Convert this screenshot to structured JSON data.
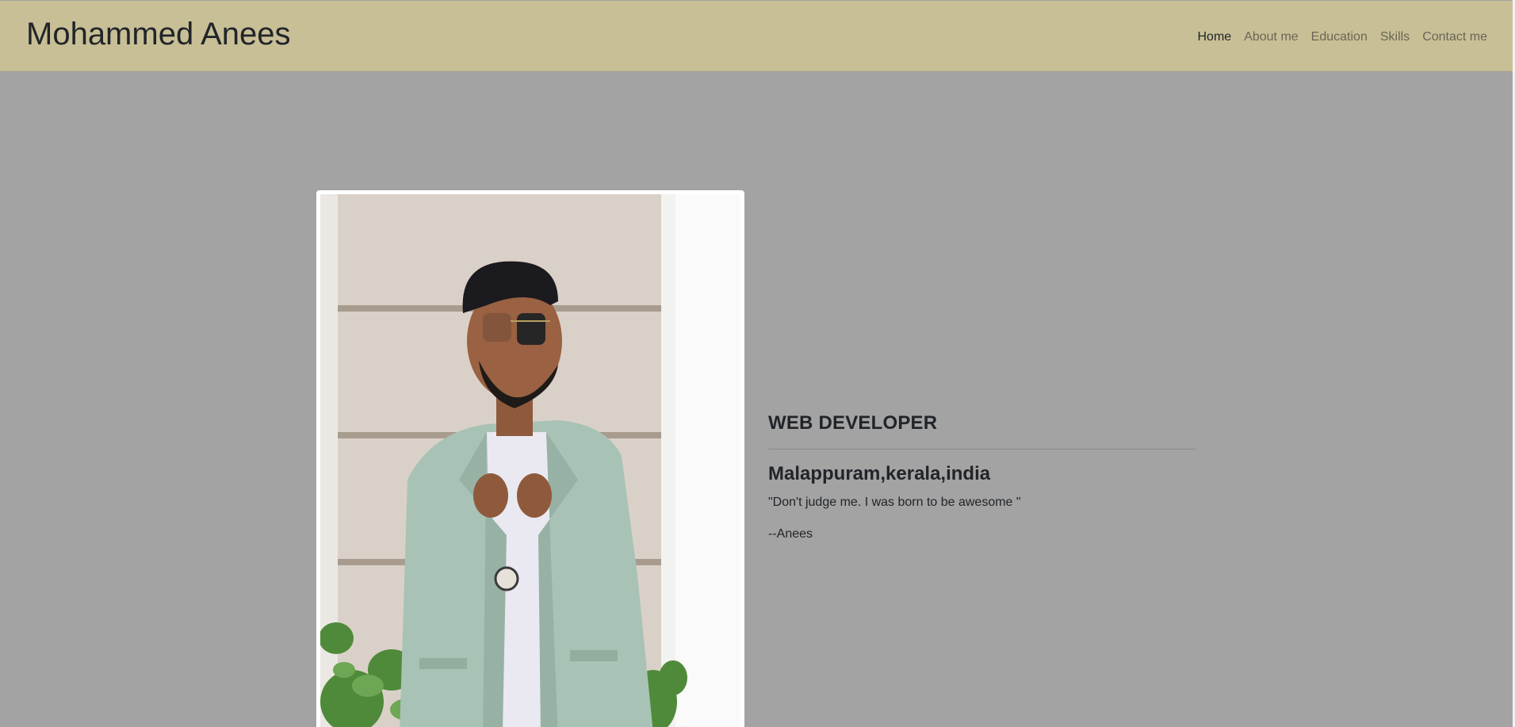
{
  "navbar": {
    "brand": "Mohammed Anees",
    "links": [
      {
        "label": "Home",
        "active": true
      },
      {
        "label": "About me"
      },
      {
        "label": "Education"
      },
      {
        "label": "Skills"
      },
      {
        "label": "Contact me"
      }
    ]
  },
  "hero": {
    "photo_alt": "Profile photo",
    "role": "WEB DEVELOPER",
    "location": "Malappuram,kerala,india",
    "quote": "\"Don't judge me. I was born to be awesome \"",
    "author": "--Anees"
  },
  "colors": {
    "navbar_bg": "#c8bf96",
    "page_bg": "#a3a3a3",
    "text": "#212529",
    "nav_inactive": "#6a6656"
  }
}
